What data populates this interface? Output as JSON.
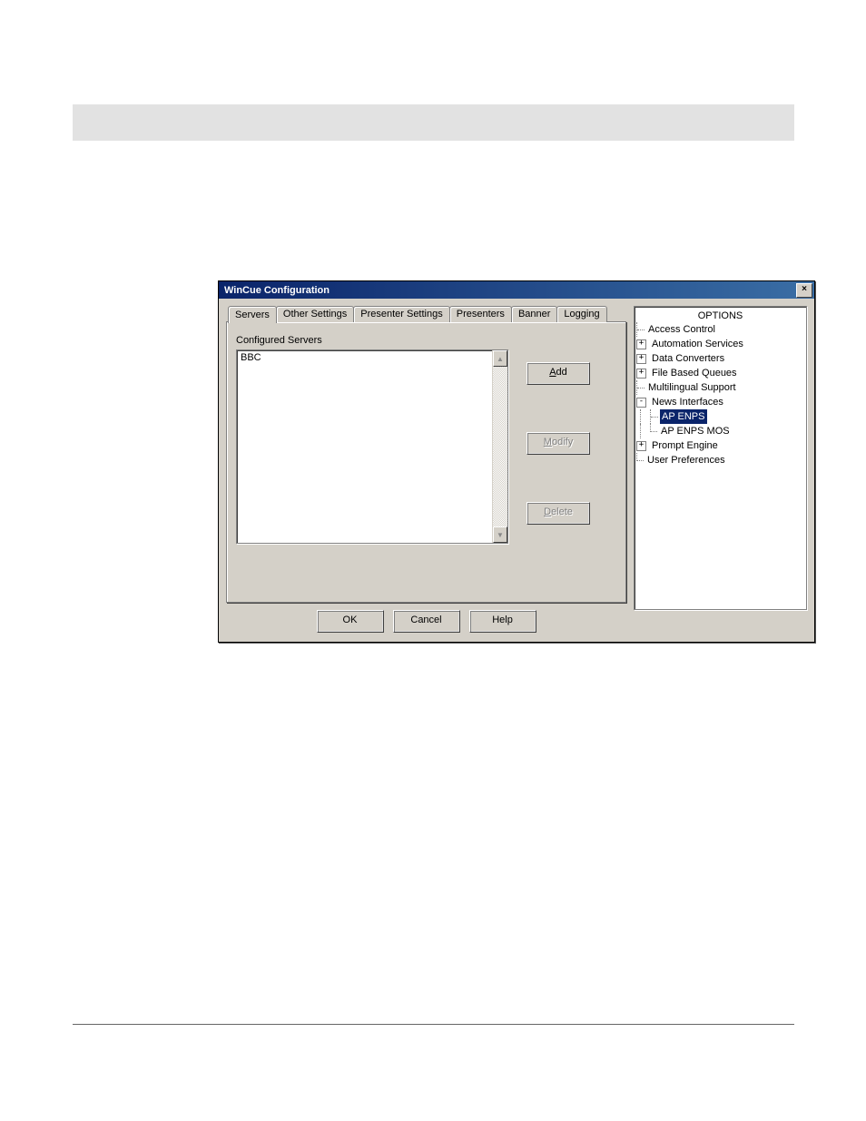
{
  "dialog": {
    "title": "WinCue Configuration",
    "close": "×"
  },
  "tabs": {
    "t0": "Servers",
    "t1": "Other Settings",
    "t2": "Presenter Settings",
    "t3": "Presenters",
    "t4": "Banner",
    "t5": "Logging"
  },
  "panel": {
    "configured_label": "Configured Servers",
    "list": {
      "item0": "BBC"
    }
  },
  "buttons": {
    "add": "Add",
    "modify": "Modify",
    "delete": "Delete",
    "ok": "OK",
    "cancel": "Cancel",
    "help": "Help"
  },
  "tree": {
    "title": "OPTIONS",
    "n0": "Access Control",
    "n1": "Automation Services",
    "n2": "Data Converters",
    "n3": "File Based Queues",
    "n4": "Multilingual Support",
    "n5": "News Interfaces",
    "n5a": "AP ENPS",
    "n5b": "AP ENPS MOS",
    "n6": "Prompt Engine",
    "n7": "User Preferences"
  }
}
